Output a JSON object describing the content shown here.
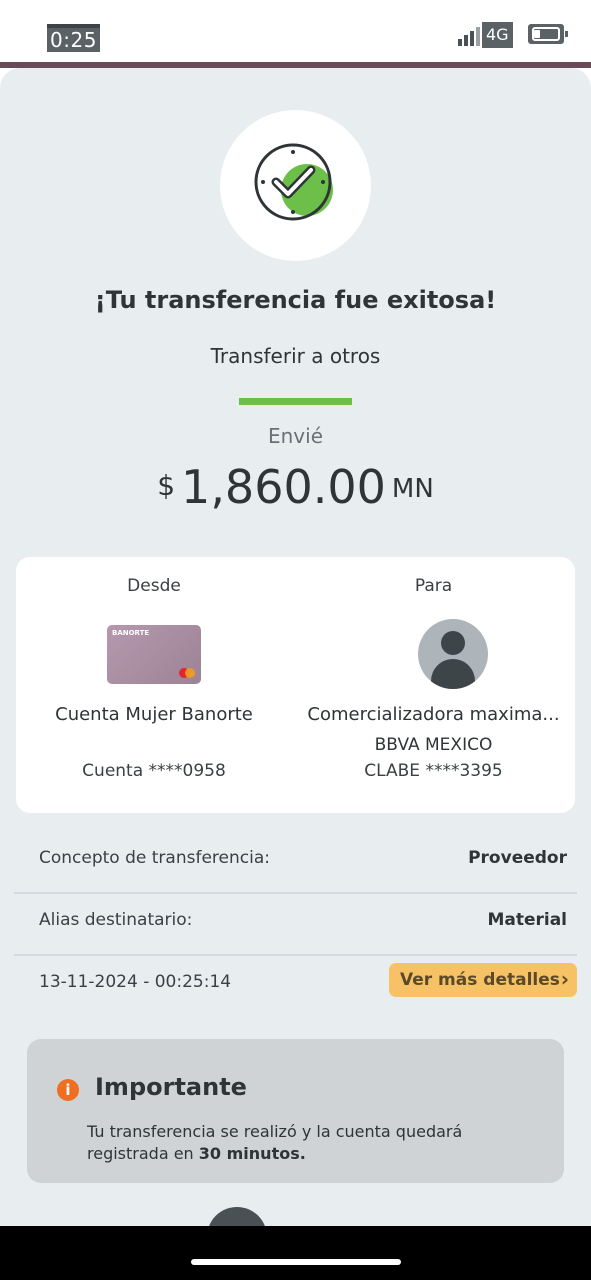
{
  "status_bar": {
    "time": "0:25",
    "network": "4G",
    "battery_level": 0.25
  },
  "success": {
    "title": "¡Tu transferencia fue exitosa!",
    "subtitle": "Transferir a otros",
    "sent_label": "Envié",
    "currency_symbol": "$",
    "amount": "1,860.00",
    "currency_code": "MN",
    "icon": "check-clock-icon",
    "accent_color": "#6cc04a"
  },
  "transfer": {
    "from": {
      "heading": "Desde",
      "card_brand": "BANORTE",
      "account_name": "Cuenta Mujer Banorte",
      "account_number": "Cuenta ****0958"
    },
    "to": {
      "heading": "Para",
      "account_name": "Comercializadora maxima...",
      "bank": "BBVA MEXICO",
      "account_number": "CLABE ****3395"
    }
  },
  "details": {
    "concept_label": "Concepto de transferencia:",
    "concept_value": "Proveedor",
    "alias_label": "Alias destinatario:",
    "alias_value": "Material",
    "timestamp": "13-11-2024 - 00:25:14",
    "more_button": "Ver más detalles",
    "more_button_color": "#f6c265"
  },
  "notice": {
    "icon": "info-icon",
    "title": "Importante",
    "text": "Tu transferencia se realizó y la cuenta quedará registrada en",
    "emphasis": "30 minutos."
  }
}
